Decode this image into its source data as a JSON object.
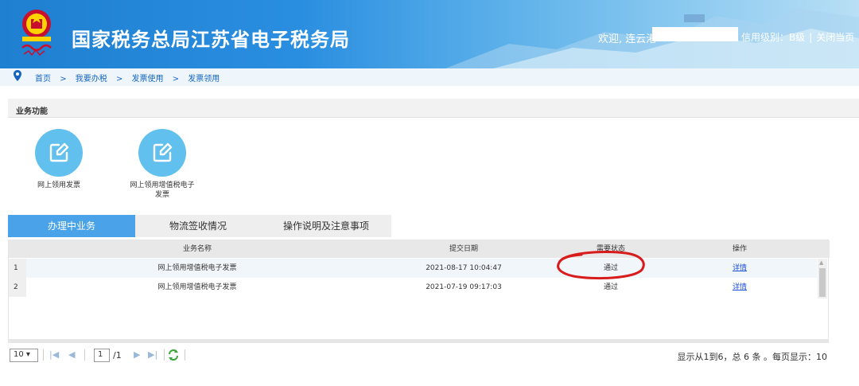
{
  "header": {
    "site_title": "国家税务总局江苏省电子税务局",
    "welcome": "欢迎, 连云港",
    "credit_level": "信用级别：B级",
    "close_label": "关闭当页"
  },
  "breadcrumb": [
    "首页",
    "我要办税",
    "发票使用",
    "发票领用"
  ],
  "business": {
    "title": "业务功能",
    "items": [
      {
        "label": "网上领用发票"
      },
      {
        "label": "网上领用增值税电子发票"
      }
    ]
  },
  "tabs": [
    {
      "label": "办理中业务",
      "active": true
    },
    {
      "label": "物流签收情况"
    },
    {
      "label": "操作说明及注意事项"
    }
  ],
  "table": {
    "headers": [
      "业务名称",
      "提交日期",
      "需要状态",
      "操作"
    ],
    "rows": [
      {
        "num": "1",
        "name": "网上领用增值税电子发票",
        "date": "2021-08-17 10:04:47",
        "status": "通过",
        "op": "详情"
      },
      {
        "num": "2",
        "name": "网上领用增值税电子发票",
        "date": "2021-07-19 09:17:03",
        "status": "通过",
        "op": "详情"
      }
    ]
  },
  "pager": {
    "page_size": "10",
    "current_page": "1",
    "total_pages": "/1",
    "info": "显示从1到6，总 6 条 。每页显示：10"
  },
  "colors": {
    "header_blue": "#1f7fd0",
    "tab_active": "#4aa3e8",
    "icon_circle": "#62c0ee",
    "annotation_red": "#d81b1b",
    "link_blue": "#1a4fd6"
  }
}
